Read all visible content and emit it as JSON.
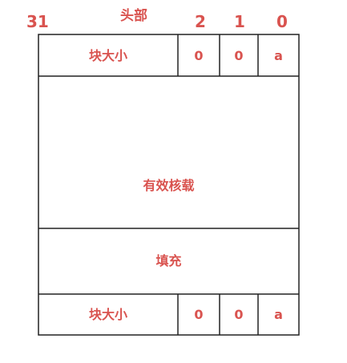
{
  "header_label": "头部",
  "bit_positions": {
    "high": "31",
    "bit2": "2",
    "bit1": "1",
    "bit0": "0"
  },
  "header_row": {
    "size_label": "块大小",
    "bit2_value": "0",
    "bit1_value": "0",
    "alloc_flag": "a"
  },
  "payload_label": "有效核载",
  "padding_label": "填充",
  "footer_row": {
    "size_label": "块大小",
    "bit2_value": "0",
    "bit1_value": "0",
    "alloc_flag": "a"
  },
  "colors": {
    "text": "#d9534f",
    "border": "#222222"
  }
}
